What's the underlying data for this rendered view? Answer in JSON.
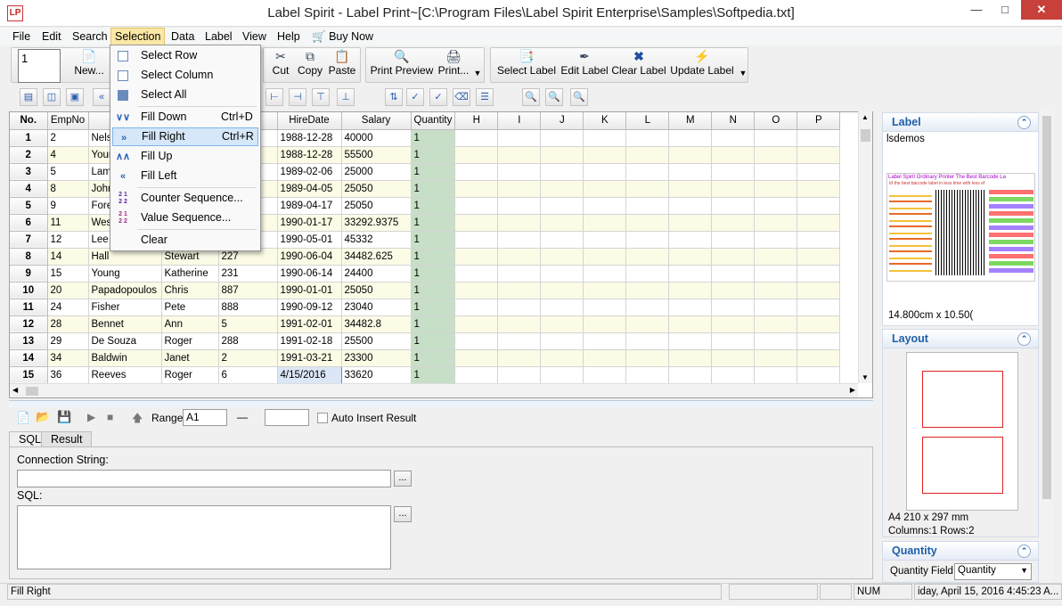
{
  "window": {
    "title": "Label Spirit - Label Print~[C:\\Program Files\\Label Spirit Enterprise\\Samples\\Softpedia.txt]",
    "app_icon": "LP"
  },
  "menubar": [
    "File",
    "Edit",
    "Search",
    "Selection",
    "Data",
    "Label",
    "View",
    "Help",
    "Buy Now"
  ],
  "toolbar": {
    "copies_value": "1",
    "new": "New...",
    "cut": "Cut",
    "copy": "Copy",
    "paste": "Paste",
    "print_preview": "Print Preview",
    "print": "Print...",
    "select_label": "Select Label",
    "edit_label": "Edit Label",
    "clear_label": "Clear Label",
    "update_label": "Update Label"
  },
  "selection_menu": {
    "select_row": "Select Row",
    "select_column": "Select Column",
    "select_all": "Select All",
    "fill_down": "Fill Down",
    "fill_down_sc": "Ctrl+D",
    "fill_right": "Fill Right",
    "fill_right_sc": "Ctrl+R",
    "fill_up": "Fill Up",
    "fill_left": "Fill Left",
    "counter_sequence": "Counter Sequence...",
    "value_sequence": "Value Sequence...",
    "clear": "Clear"
  },
  "grid": {
    "headers": [
      "No.",
      "EmpNo",
      "L",
      "",
      "xt",
      "HireDate",
      "Salary",
      "Quantity",
      "H",
      "I",
      "J",
      "K",
      "L",
      "M",
      "N",
      "O",
      "P"
    ],
    "rows": [
      [
        "1",
        "2",
        "Nels",
        "",
        "",
        "1988-12-28",
        "40000",
        "1"
      ],
      [
        "2",
        "4",
        "Your",
        "",
        "",
        "1988-12-28",
        "55500",
        "1"
      ],
      [
        "3",
        "5",
        "Lam",
        "",
        "",
        "1989-02-06",
        "25000",
        "1"
      ],
      [
        "4",
        "8",
        "John",
        "",
        "",
        "1989-04-05",
        "25050",
        "1"
      ],
      [
        "5",
        "9",
        "Fore",
        "",
        "",
        "1989-04-17",
        "25050",
        "1"
      ],
      [
        "6",
        "11",
        "Wes",
        "",
        "",
        "1990-01-17",
        "33292.9375",
        "1"
      ],
      [
        "7",
        "12",
        "Lee",
        "",
        "",
        "1990-05-01",
        "45332",
        "1"
      ],
      [
        "8",
        "14",
        "Hall",
        "Stewart",
        "227",
        "1990-06-04",
        "34482.625",
        "1"
      ],
      [
        "9",
        "15",
        "Young",
        "Katherine",
        "231",
        "1990-06-14",
        "24400",
        "1"
      ],
      [
        "10",
        "20",
        "Papadopoulos",
        "Chris",
        "887",
        "1990-01-01",
        "25050",
        "1"
      ],
      [
        "11",
        "24",
        "Fisher",
        "Pete",
        "888",
        "1990-09-12",
        "23040",
        "1"
      ],
      [
        "12",
        "28",
        "Bennet",
        "Ann",
        "5",
        "1991-02-01",
        "34482.8",
        "1"
      ],
      [
        "13",
        "29",
        "De Souza",
        "Roger",
        "288",
        "1991-02-18",
        "25500",
        "1"
      ],
      [
        "14",
        "34",
        "Baldwin",
        "Janet",
        "2",
        "1991-03-21",
        "23300",
        "1"
      ],
      [
        "15",
        "36",
        "Reeves",
        "Roger",
        "6",
        "4/15/2016",
        "33620",
        "1"
      ]
    ]
  },
  "sql": {
    "range_label": "Range:",
    "range_value": "A1",
    "range_dash": "—",
    "auto_insert": "Auto Insert Result",
    "tab_sql": "SQL",
    "tab_result": "Result",
    "connection_label": "Connection String:",
    "sql_label": "SQL:",
    "browse": "..."
  },
  "right_panel": {
    "label_title": "Label",
    "label_name": "lsdemos",
    "label_size": "14.800cm x 10.50(",
    "layout_title": "Layout",
    "layout_paper": "A4 210 x 297 mm",
    "layout_grid": "Columns:1 Rows:2",
    "quantity_title": "Quantity",
    "quantity_field_label": "Quantity Field:",
    "quantity_field_value": "Quantity"
  },
  "preview_text": {
    "line1": "Label Spirit Ordinary Printer The Best Barcode La",
    "line2": "Id the best barcode label in less time with less ef"
  },
  "statusbar": {
    "message": "Fill Right",
    "num": "NUM",
    "datetime": "iday, April 15, 2016 4:45:23 A..."
  },
  "colors": {
    "highlight": "#d5e7f8",
    "quantity_col": "#c6dfc6",
    "row_alt": "#fcfbe6",
    "panel_header": "#1f5fa8"
  }
}
